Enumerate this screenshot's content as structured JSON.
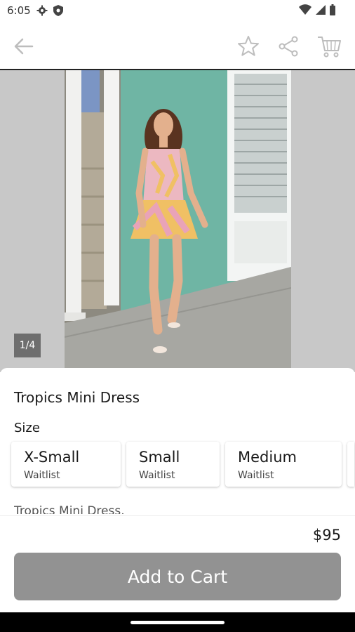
{
  "status_bar": {
    "time": "6:05",
    "icons": [
      "gear-icon",
      "shield-icon",
      "wifi-icon",
      "signal-icon",
      "battery-icon"
    ]
  },
  "top_bar": {
    "icons": [
      "back-arrow-icon",
      "star-icon",
      "share-icon",
      "cart-icon"
    ]
  },
  "gallery": {
    "counter": "1/4",
    "current_index": 1,
    "total": 4
  },
  "product": {
    "title": "Tropics Mini Dress",
    "size_label": "Size",
    "sizes": [
      {
        "name": "X-Small",
        "status": "Waitlist"
      },
      {
        "name": "Small",
        "status": "Waitlist"
      },
      {
        "name": "Medium",
        "status": "Waitlist"
      }
    ],
    "description": "Tropics Mini Dress.",
    "price": "$95",
    "add_to_cart_label": "Add to Cart"
  },
  "colors": {
    "button_bg": "#929292",
    "accent_wall": "#6fb5a4"
  }
}
